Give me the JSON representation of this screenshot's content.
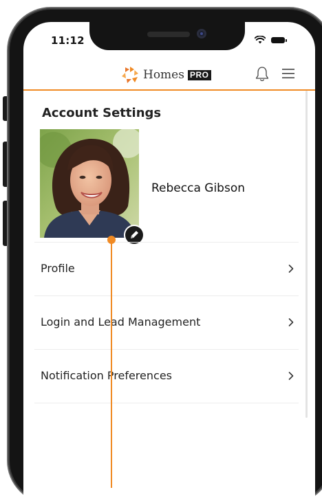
{
  "status_bar": {
    "time": "11:12"
  },
  "header": {
    "brand_name": "Homes",
    "brand_badge": "PRO",
    "brand_colors": {
      "orange": "#f08a24",
      "dark": "#1a1a1a"
    },
    "icons": [
      "bell-icon",
      "menu-icon"
    ]
  },
  "account": {
    "title": "Account Settings",
    "user_name": "Rebecca Gibson",
    "avatar_icon": "user-photo",
    "edit_icon": "pencil-icon"
  },
  "menu": {
    "items": [
      {
        "label": "Profile"
      },
      {
        "label": "Login and Lead Management"
      },
      {
        "label": "Notification Preferences"
      }
    ]
  },
  "accent_color": "#f08a24"
}
